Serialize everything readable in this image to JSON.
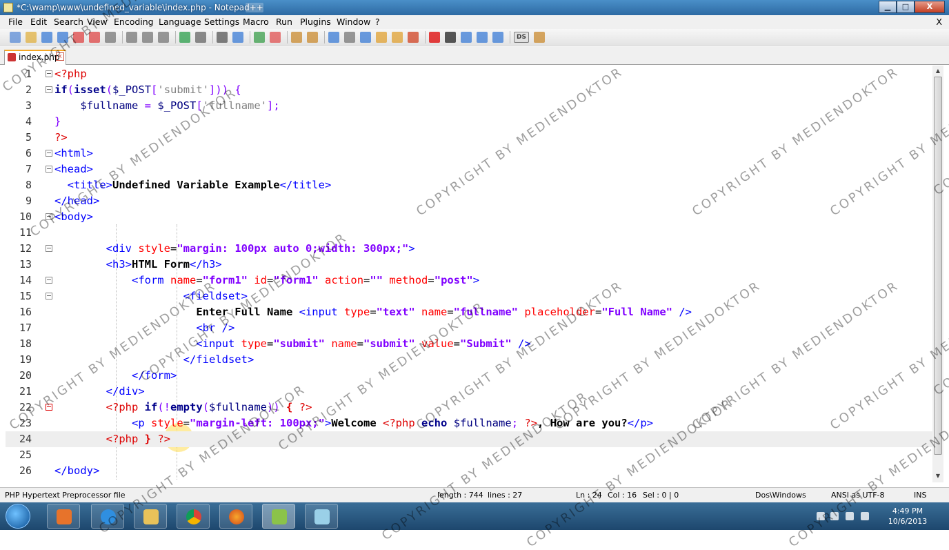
{
  "window": {
    "title": "*C:\\wamp\\www\\undefined_variable\\index.php - Notepad++",
    "buttons": {
      "minimize": "▁",
      "maximize": "□",
      "close": "X"
    }
  },
  "menu": {
    "items": [
      "File",
      "Edit",
      "Search",
      "View",
      "Encoding",
      "Language",
      "Settings",
      "Macro",
      "Run",
      "Plugins",
      "Window",
      "?"
    ],
    "close_doc": "X"
  },
  "toolbar": {
    "icons": [
      "new-icon",
      "open-icon",
      "save-icon",
      "save-all-icon",
      "close-icon",
      "close-all-icon",
      "print-icon",
      "cut-icon",
      "copy-icon",
      "paste-icon",
      "undo-icon",
      "redo-icon",
      "find-icon",
      "replace-icon",
      "zoom-in-icon",
      "zoom-out-icon",
      "sync-v-icon",
      "sync-h-icon",
      "word-wrap-icon",
      "show-all-icon",
      "indent-guide-icon",
      "udl-icon",
      "doc-map-icon",
      "function-list-icon",
      "record-icon",
      "stop-icon",
      "play-icon",
      "play-multi-icon",
      "save-macro-icon",
      "ds-icon",
      "misc-icon"
    ],
    "ds_label": "DS"
  },
  "tab": {
    "label": "index.php",
    "close": "x"
  },
  "editor": {
    "lines": [
      {
        "n": "1",
        "fold": "box",
        "html": "<span style=\"color:#d00\">&lt;?php</span>"
      },
      {
        "n": "2",
        "fold": "box",
        "html": "<b style=\"color:#00008b\">if</b><span style=\"color:#8000ff\">(</span><b style=\"color:#00008b\">isset</b><span style=\"color:#8000ff\">(</span><span style=\"color:#000080\">$_POST</span><span style=\"color:#8000ff\">[</span><span style=\"color:#808080\">'submit'</span><span style=\"color:#8000ff\">])) {</span>"
      },
      {
        "n": "3",
        "fold": "",
        "html": "    <span style=\"color:#000080\">$fullname</span> <span style=\"color:#8000ff\">=</span> <span style=\"color:#000080\">$_POST</span><span style=\"color:#8000ff\">[</span><span style=\"color:#808080\">'fullname'</span><span style=\"color:#8000ff\">];</span>"
      },
      {
        "n": "4",
        "fold": "",
        "html": "<span style=\"color:#8000ff\">}</span>"
      },
      {
        "n": "5",
        "fold": "",
        "html": "<span style=\"color:#d00\">?&gt;</span>"
      },
      {
        "n": "6",
        "fold": "box",
        "html": "<span style=\"color:#00f\">&lt;html&gt;</span>"
      },
      {
        "n": "7",
        "fold": "box",
        "html": "<span style=\"color:#00f\">&lt;head&gt;</span>"
      },
      {
        "n": "8",
        "fold": "",
        "html": "  <span style=\"color:#00f\">&lt;title&gt;</span><b>Undefined Variable Example</b><span style=\"color:#00f\">&lt;/title&gt;</span>"
      },
      {
        "n": "9",
        "fold": "",
        "html": "<span style=\"color:#00f\">&lt;/head&gt;</span>"
      },
      {
        "n": "10",
        "fold": "box",
        "html": "<span style=\"color:#00f\">&lt;body&gt;</span>"
      },
      {
        "n": "11",
        "fold": "",
        "html": ""
      },
      {
        "n": "12",
        "fold": "box",
        "html": "        <span style=\"color:#00f\">&lt;div</span> <span style=\"color:#f00\">style</span><span style=\"color:#000\">=</span><b style=\"color:#8000ff\">\"margin: 100px auto 0;width: 300px;\"</b><span style=\"color:#00f\">&gt;</span>"
      },
      {
        "n": "13",
        "fold": "",
        "html": "        <span style=\"color:#00f\">&lt;h3&gt;</span><b>HTML Form</b><span style=\"color:#00f\">&lt;/h3&gt;</span>"
      },
      {
        "n": "14",
        "fold": "box",
        "html": "            <span style=\"color:#00f\">&lt;form</span> <span style=\"color:#f00\">name</span>=<b style=\"color:#8000ff\">\"form1\"</b> <span style=\"color:#f00\">id</span>=<b style=\"color:#8000ff\">\"form1\"</b> <span style=\"color:#f00\">action</span>=<b style=\"color:#8000ff\">\"\"</b> <span style=\"color:#f00\">method</span>=<b style=\"color:#8000ff\">\"post\"</b><span style=\"color:#00f\">&gt;</span>"
      },
      {
        "n": "15",
        "fold": "box",
        "html": "                    <span style=\"color:#00f\">&lt;fieldset&gt;</span>"
      },
      {
        "n": "16",
        "fold": "",
        "html": "                      <b>Enter Full Name</b> <span style=\"color:#00f\">&lt;input</span> <span style=\"color:#f00\">type</span>=<b style=\"color:#8000ff\">\"text\"</b> <span style=\"color:#f00\">name</span>=<b style=\"color:#8000ff\">\"fullname\"</b> <span style=\"color:#f00\">placeholder</span>=<b style=\"color:#8000ff\">\"Full Name\"</b> <span style=\"color:#00f\">/&gt;</span>"
      },
      {
        "n": "17",
        "fold": "",
        "html": "                      <span style=\"color:#00f\">&lt;br /&gt;</span>"
      },
      {
        "n": "18",
        "fold": "",
        "html": "                      <span style=\"color:#00f\">&lt;input</span> <span style=\"color:#f00\">type</span>=<b style=\"color:#8000ff\">\"submit\"</b> <span style=\"color:#f00\">name</span>=<b style=\"color:#8000ff\">\"submit\"</b> <span style=\"color:#f00\">value</span>=<b style=\"color:#8000ff\">\"Submit\"</b> <span style=\"color:#00f\">/&gt;</span>"
      },
      {
        "n": "19",
        "fold": "",
        "html": "                    <span style=\"color:#00f\">&lt;/fieldset&gt;</span>"
      },
      {
        "n": "20",
        "fold": "",
        "html": "            <span style=\"color:#00f\">&lt;/form&gt;</span>"
      },
      {
        "n": "21",
        "fold": "",
        "html": "        <span style=\"color:#00f\">&lt;/div&gt;</span>"
      },
      {
        "n": "22",
        "fold": "red",
        "html": "        <span style=\"color:#d00\">&lt;?php</span> <b style=\"color:#00008b\">if</b><span style=\"color:#8000ff\">(!</span><b style=\"color:#00008b\">empty</b><span style=\"color:#8000ff\">(</span><span style=\"color:#000080\">$fullname</span><span style=\"color:#8000ff\">))</span> <b style=\"color:#d00\">{</b> <span style=\"color:#d00\">?&gt;</span>"
      },
      {
        "n": "23",
        "fold": "",
        "html": "            <span style=\"color:#00f\">&lt;p</span> <span style=\"color:#f00\">style</span>=<b style=\"color:#8000ff\">\"margin-left: 100px;\"</b><span style=\"color:#00f\">&gt;</span><b>Welcome</b> <span style=\"color:#d00\">&lt;?php</span> <b style=\"color:#00008b\">echo</b> <span style=\"color:#000080\">$fullname</span><span style=\"color:#8000ff\">;</span> <span style=\"color:#d00\">?&gt;</span><b>, How are you?</b><span style=\"color:#00f\">&lt;/p&gt;</span>"
      },
      {
        "n": "24",
        "fold": "",
        "html": "        <span style=\"color:#d00\">&lt;?php</span> <b style=\"color:#d00\">}</b> <span style=\"color:#d00\">?&gt;</span>",
        "current": true
      },
      {
        "n": "25",
        "fold": "",
        "html": ""
      },
      {
        "n": "26",
        "fold": "",
        "html": "<span style=\"color:#00f\">&lt;/body&gt;</span>"
      }
    ]
  },
  "status": {
    "filetype": "PHP Hypertext Preprocessor file",
    "length": "length : 744",
    "lines": "lines : 27",
    "ln": "Ln : 24",
    "col": "Col : 16",
    "sel": "Sel : 0 | 0",
    "eol": "Dos\\Windows",
    "encoding": "ANSI as UTF-8",
    "mode": "INS"
  },
  "taskbar": {
    "apps": [
      "media-player-icon",
      "internet-explorer-icon",
      "file-explorer-icon",
      "chrome-icon",
      "firefox-icon",
      "notepad-plus-plus-icon",
      "misc-app-icon"
    ],
    "time": "4:49 PM",
    "date": "10/6/2013"
  },
  "watermark": "COPYRIGHT BY MEDIENDOKTOR",
  "colors": {
    "accent": "#2d6aa3",
    "tab_active": "#f5a623"
  }
}
